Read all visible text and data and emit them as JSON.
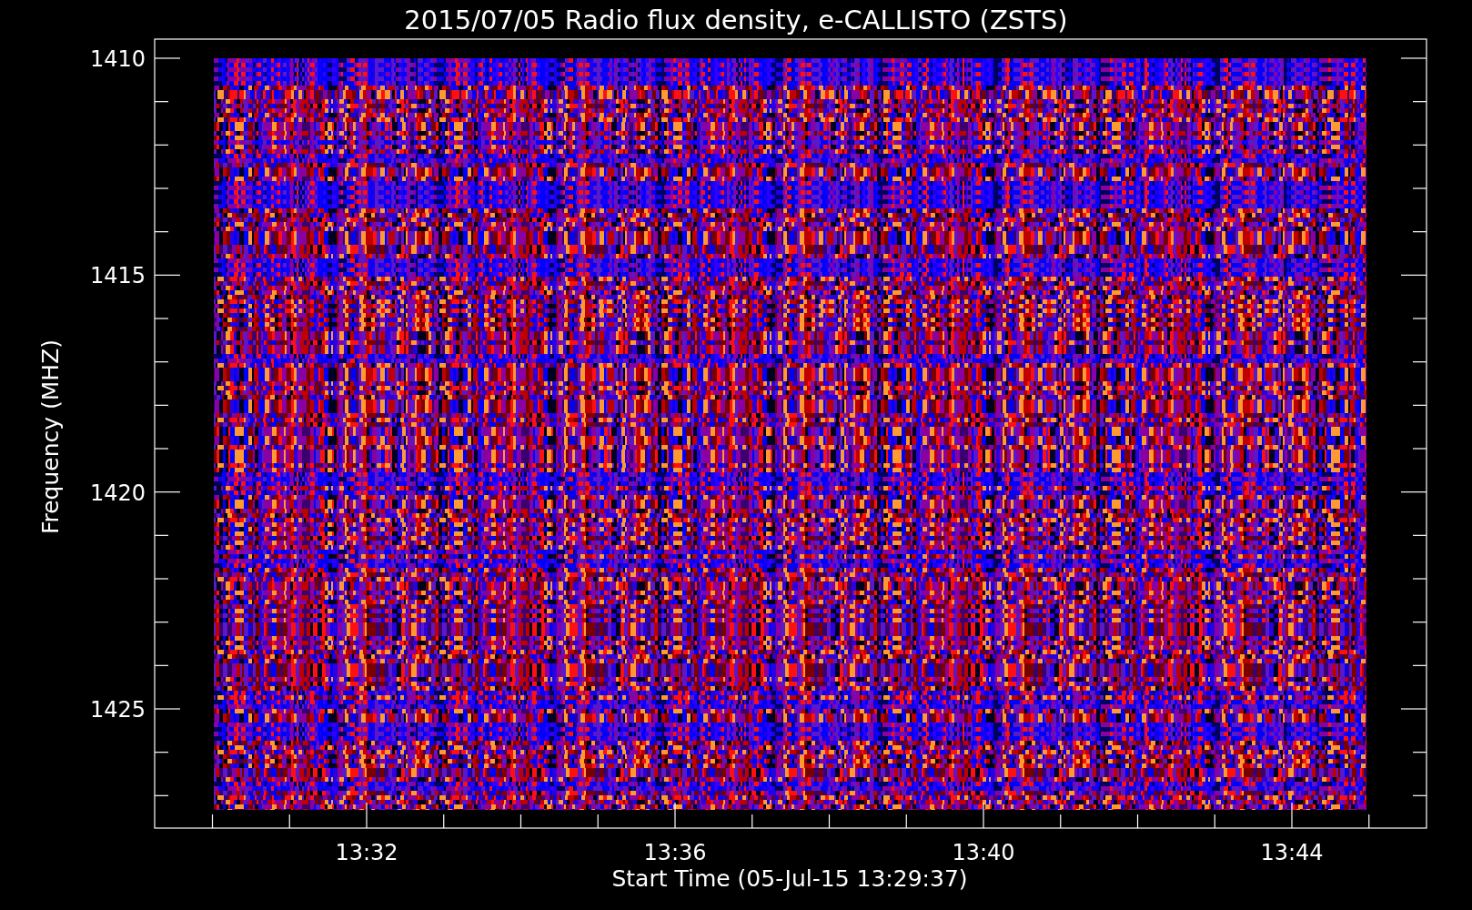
{
  "title": "2015/07/05  Radio flux density, e-CALLISTO (ZSTS)",
  "y_axis": {
    "label": "Frequency (MHZ)",
    "ticks": [
      "1410",
      "1415",
      "1420",
      "1425"
    ]
  },
  "x_axis": {
    "label": "Start Time (05-Jul-15 13:29:37)",
    "ticks": [
      "13:32",
      "13:36",
      "13:40",
      "13:44"
    ]
  }
}
